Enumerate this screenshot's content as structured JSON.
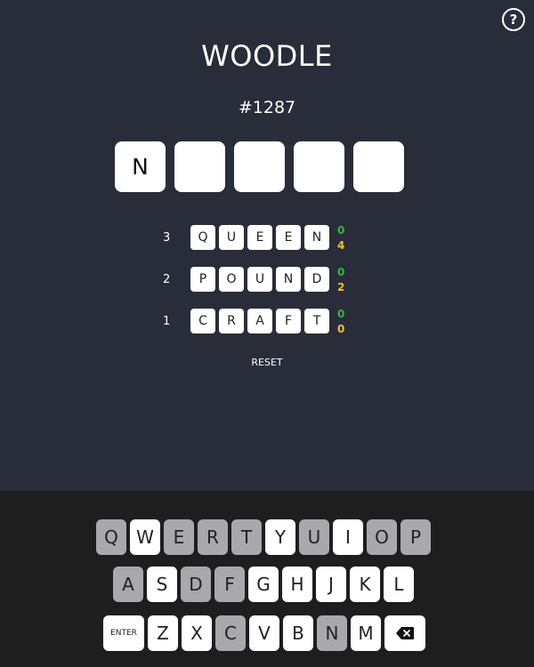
{
  "header": {
    "title": "WOODLE",
    "help_icon": "?"
  },
  "puzzle": {
    "number": "#1287"
  },
  "current_input": [
    "N",
    "",
    "",
    "",
    ""
  ],
  "guesses": [
    {
      "index": "3",
      "letters": [
        "Q",
        "U",
        "E",
        "E",
        "N"
      ],
      "green": "0",
      "yellow": "4"
    },
    {
      "index": "2",
      "letters": [
        "P",
        "O",
        "U",
        "N",
        "D"
      ],
      "green": "0",
      "yellow": "2"
    },
    {
      "index": "1",
      "letters": [
        "C",
        "R",
        "A",
        "F",
        "T"
      ],
      "green": "0",
      "yellow": "0"
    }
  ],
  "reset_label": "RESET",
  "keyboard": {
    "rows": [
      [
        {
          "label": "Q",
          "used": true
        },
        {
          "label": "W",
          "used": false
        },
        {
          "label": "E",
          "used": true
        },
        {
          "label": "R",
          "used": true
        },
        {
          "label": "T",
          "used": true
        },
        {
          "label": "Y",
          "used": false
        },
        {
          "label": "U",
          "used": true
        },
        {
          "label": "I",
          "used": false
        },
        {
          "label": "O",
          "used": true
        },
        {
          "label": "P",
          "used": true
        }
      ],
      [
        {
          "label": "A",
          "used": true
        },
        {
          "label": "S",
          "used": false
        },
        {
          "label": "D",
          "used": true
        },
        {
          "label": "F",
          "used": true
        },
        {
          "label": "G",
          "used": false
        },
        {
          "label": "H",
          "used": false
        },
        {
          "label": "J",
          "used": false
        },
        {
          "label": "K",
          "used": false
        },
        {
          "label": "L",
          "used": false
        }
      ],
      [
        {
          "label": "ENTER",
          "used": false,
          "kind": "enter"
        },
        {
          "label": "Z",
          "used": false
        },
        {
          "label": "X",
          "used": false
        },
        {
          "label": "C",
          "used": true
        },
        {
          "label": "V",
          "used": false
        },
        {
          "label": "B",
          "used": false
        },
        {
          "label": "N",
          "used": true
        },
        {
          "label": "M",
          "used": false
        },
        {
          "label": "",
          "used": false,
          "kind": "backspace",
          "icon": "backspace-icon"
        }
      ]
    ]
  },
  "colors": {
    "background": "#292d3a",
    "keyboard_bg": "#1e1e1e",
    "used_key": "#a8a8ad",
    "green": "#3fae49",
    "yellow": "#f2bf3c"
  }
}
